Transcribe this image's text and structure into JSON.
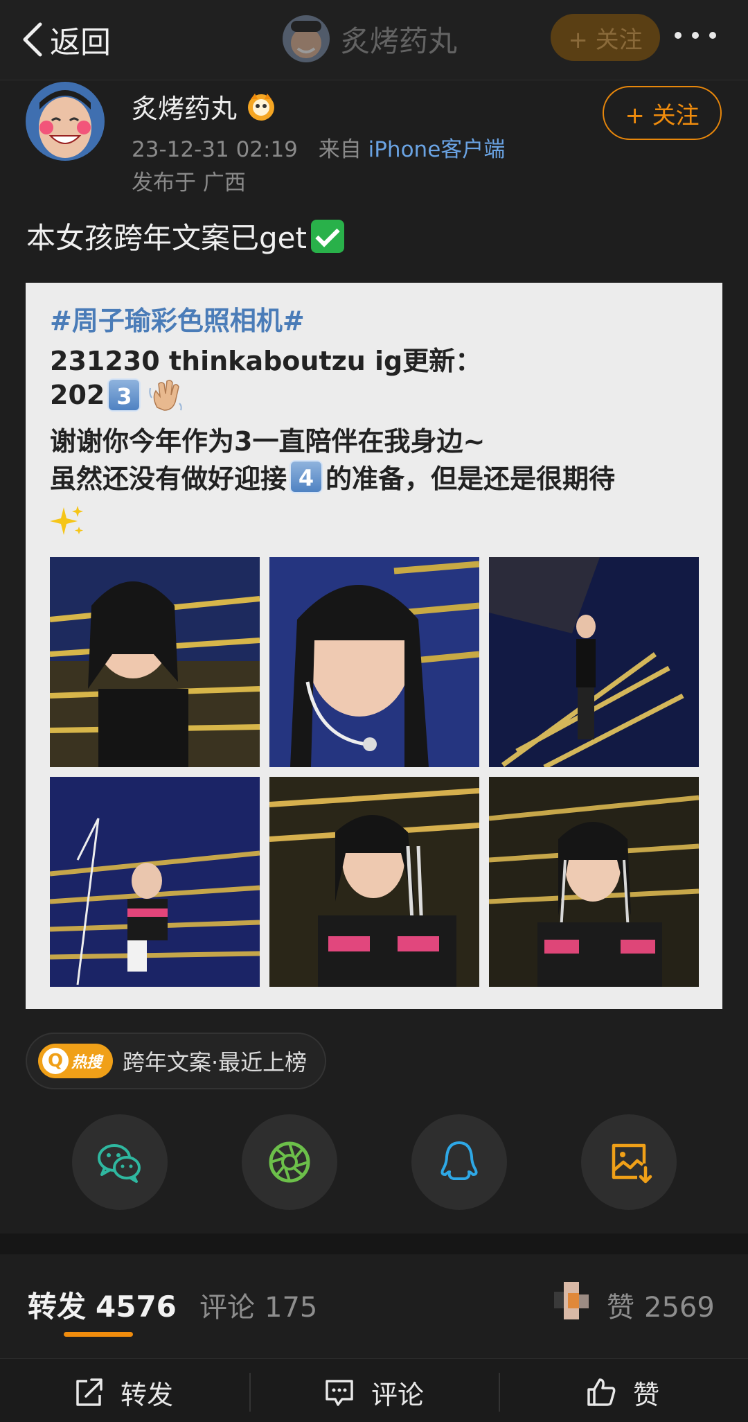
{
  "nav": {
    "back_label": "返回",
    "title": "炙烤药丸",
    "follow_label": "+ 关注"
  },
  "author": {
    "name": "炙烤药丸",
    "timestamp": "23-12-31 02:19",
    "source_prefix": "来自",
    "source_device": "iPhone客户端",
    "location": "发布于 广西",
    "follow_label": "+ 关注"
  },
  "post": {
    "text": "本女孩跨年文案已get"
  },
  "card": {
    "hashtag": "#周子瑜彩色照相机#",
    "line1": "231230 thinkaboutzu ig更新：",
    "line2_prefix": "202",
    "line2_key": "3",
    "line3": "谢谢你今年作为3一直陪伴在我身边~",
    "line4_prefix": "虽然还没有做好迎接",
    "line4_key": "4",
    "line4_suffix": "的准备，但是还是很期待"
  },
  "hot_search": {
    "tag": "热搜",
    "text": "跨年文案·最近上榜"
  },
  "share_icons": [
    "wechat-icon",
    "moments-icon",
    "qq-icon",
    "save-image-icon"
  ],
  "stats": {
    "repost_label": "转发",
    "repost_count": "4576",
    "comment_label": "评论",
    "comment_count": "175",
    "like_label": "赞",
    "like_count": "2569"
  },
  "bottom_bar": {
    "repost": "转发",
    "comment": "评论",
    "like": "赞"
  },
  "colors": {
    "accent": "#f08c0d",
    "link": "#6aa3e3",
    "background": "#1e1e1e"
  }
}
